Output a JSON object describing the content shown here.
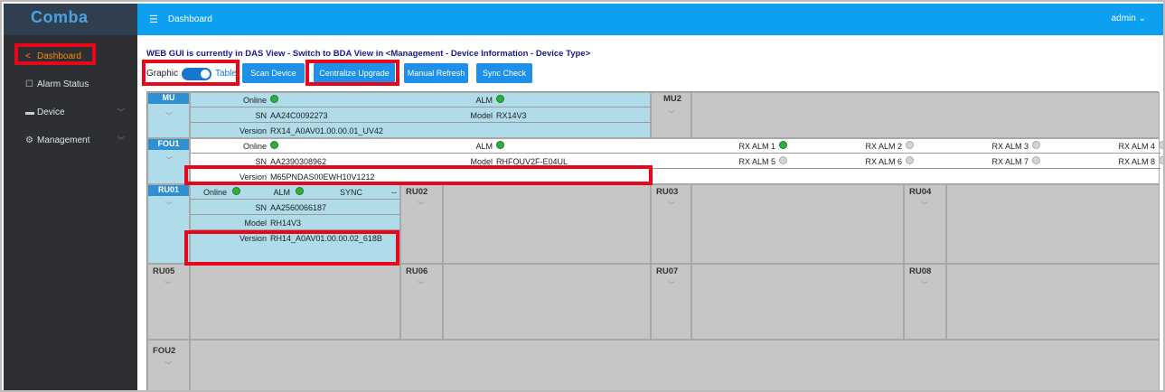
{
  "app": {
    "logo": "Comba",
    "page_title": "Dashboard",
    "user": "admin"
  },
  "sidebar": {
    "items": [
      {
        "label": "Dashboard",
        "icon": "share-icon",
        "active": true
      },
      {
        "label": "Alarm Status",
        "icon": "monitor-icon"
      },
      {
        "label": "Device",
        "icon": "device-icon"
      },
      {
        "label": "Management",
        "icon": "gear-icon"
      }
    ]
  },
  "notice": "WEB GUI is currently in DAS View - Switch to BDA View in <Management - Device Information - Device Type>",
  "toolbar": {
    "graphic": "Graphic",
    "table": "Table",
    "buttons": [
      "Scan Device",
      "Centralize Upgrade",
      "Manual Refresh",
      "Sync Check"
    ]
  },
  "mu": {
    "label": "MU",
    "online": "Online",
    "alm": "ALM",
    "sn_key": "SN",
    "sn": "AA24C0092273",
    "model_key": "Model",
    "model": "RX14V3",
    "version_key": "Version",
    "version": "RX14_A0AV01.00.00.01_UV42"
  },
  "mu2": {
    "label": "MU2"
  },
  "fou1": {
    "label": "FOU1",
    "online": "Online",
    "alm": "ALM",
    "sn_key": "SN",
    "sn": "AA2390308962",
    "model_key": "Model",
    "model": "RHFOUV2F-E04UL",
    "version_key": "Version",
    "version": "M65PNDAS00EWH10V1212",
    "rx": [
      "RX ALM 1",
      "RX ALM 2",
      "RX ALM 3",
      "RX ALM 4",
      "RX ALM 5",
      "RX ALM 6",
      "RX ALM 7",
      "RX ALM 8"
    ]
  },
  "ru01": {
    "label": "RU01",
    "online": "Online",
    "alm": "ALM",
    "sync": "SYNC",
    "dash": "--",
    "sn_key": "SN",
    "sn": "AA2560066187",
    "model_key": "Model",
    "model": "RH14V3",
    "version_key": "Version",
    "version": "RH14_A0AV01.00.00.02_618B"
  },
  "slots": {
    "ru02": "RU02",
    "ru03": "RU03",
    "ru04": "RU04",
    "ru05": "RU05",
    "ru06": "RU06",
    "ru07": "RU07",
    "ru08": "RU08",
    "fou2": "FOU2"
  },
  "colors": {
    "accent": "#0d9ff0",
    "sidebar": "#2d2f33",
    "active": "#ff8a00",
    "highlight": "#e8071a",
    "online": "#2fae3d"
  }
}
